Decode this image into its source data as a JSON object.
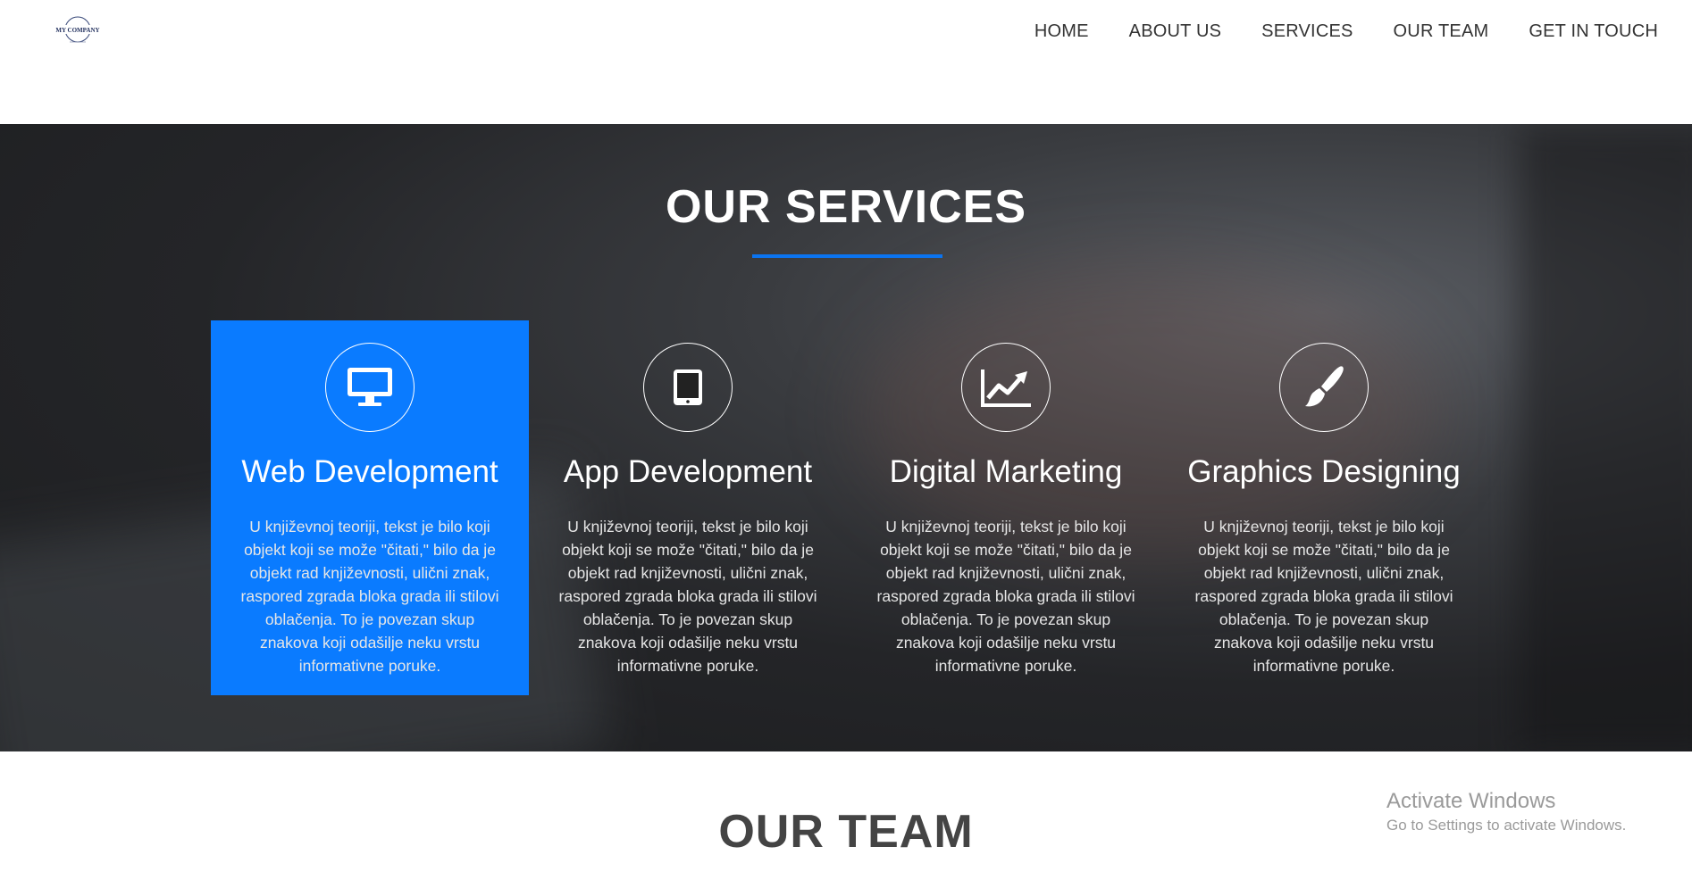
{
  "header": {
    "logo_text": "MY COMPANY",
    "nav": [
      {
        "label": "HOME"
      },
      {
        "label": "ABOUT US"
      },
      {
        "label": "SERVICES"
      },
      {
        "label": "OUR TEAM"
      },
      {
        "label": "GET IN TOUCH"
      }
    ]
  },
  "services": {
    "title": "OUR SERVICES",
    "accent_color": "#0a7bff",
    "cards": [
      {
        "icon": "monitor-icon",
        "title": "Web Development",
        "text": "U književnoj teoriji, tekst je bilo koji objekt koji se može \"čitati,\" bilo da je objekt rad književnosti, ulični znak, raspored zgrada bloka grada ili stilovi oblačenja. To je povezan skup znakova koji odašilje neku vrstu informativne poruke.",
        "active": true
      },
      {
        "icon": "tablet-icon",
        "title": "App Development",
        "text": "U književnoj teoriji, tekst je bilo koji objekt koji se može \"čitati,\" bilo da je objekt rad književnosti, ulični znak, raspored zgrada bloka grada ili stilovi oblačenja. To je povezan skup znakova koji odašilje neku vrstu informativne poruke.",
        "active": false
      },
      {
        "icon": "chart-line-icon",
        "title": "Digital Marketing",
        "text": "U književnoj teoriji, tekst je bilo koji objekt koji se može \"čitati,\" bilo da je objekt rad književnosti, ulični znak, raspored zgrada bloka grada ili stilovi oblačenja. To je povezan skup znakova koji odašilje neku vrstu informativne poruke.",
        "active": false
      },
      {
        "icon": "paint-brush-icon",
        "title": "Graphics Designing",
        "text": "U književnoj teoriji, tekst je bilo koji objekt koji se može \"čitati,\" bilo da je objekt rad književnosti, ulični znak, raspored zgrada bloka grada ili stilovi oblačenja. To je povezan skup znakova koji odašilje neku vrstu informativne poruke.",
        "active": false
      }
    ]
  },
  "team": {
    "title": "OUR TEAM"
  },
  "watermark": {
    "line1": "Activate Windows",
    "line2": "Go to Settings to activate Windows."
  }
}
